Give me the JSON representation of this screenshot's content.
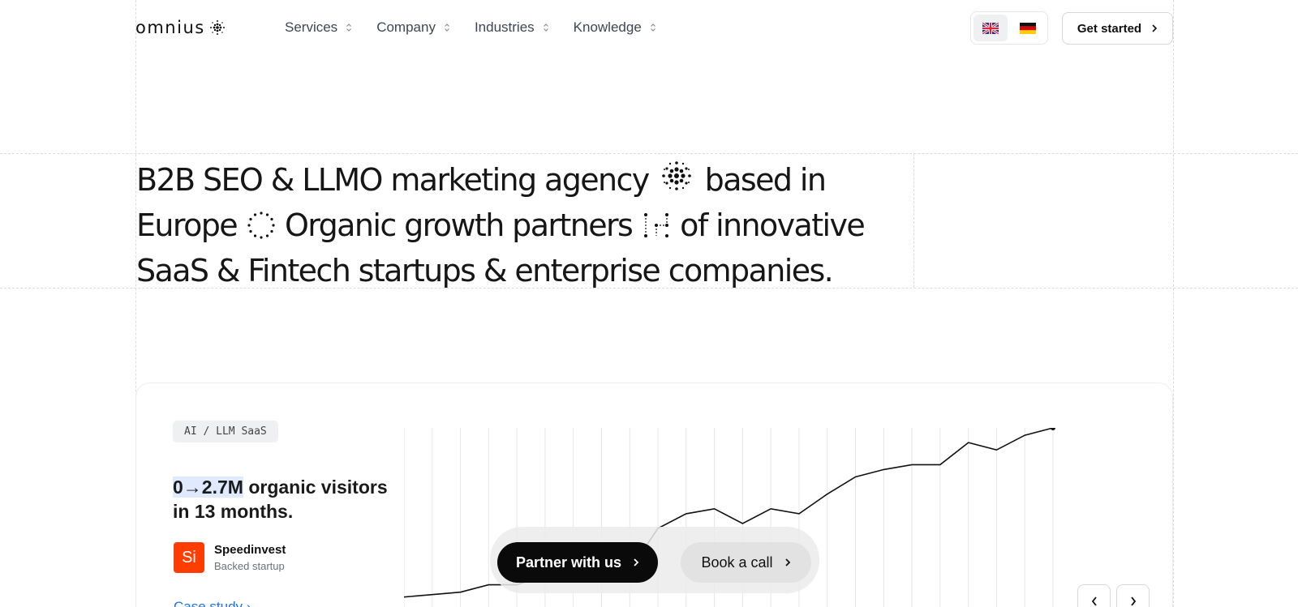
{
  "header": {
    "logo_text": "omnius",
    "nav": [
      {
        "label": "Services"
      },
      {
        "label": "Company"
      },
      {
        "label": "Industries"
      },
      {
        "label": "Knowledge"
      }
    ],
    "cta_label": "Get started"
  },
  "hero": {
    "part1": "B2B SEO & LLMO marketing agency",
    "part2": "based in Europe",
    "part3": "Organic growth partners",
    "part4": "of innovative SaaS & Fintech startups & enterprise companies."
  },
  "case": {
    "tag": "AI / LLM SaaS",
    "metric": "0→2.7M",
    "headline_rest": "organic visitors in 13 months.",
    "company_initials": "Si",
    "company_name": "Speedinvest",
    "company_sub": "Backed startup",
    "link_label": "Case study",
    "brand_color": "#ff3d00"
  },
  "actions": {
    "partner_label": "Partner with us",
    "book_label": "Book a call"
  },
  "chart_data": {
    "type": "line",
    "series": [
      {
        "values": [
          1.2,
          1.3,
          1.4,
          1.7,
          1.7,
          2.1,
          2.0,
          2.4,
          2.3,
          4.0,
          4.6,
          4.8,
          4.2,
          4.8,
          4.6,
          5.4,
          6.1,
          6.4,
          6.6,
          6.6,
          7.5,
          7.2,
          7.8,
          8.1
        ]
      }
    ],
    "grid": "vertical"
  }
}
